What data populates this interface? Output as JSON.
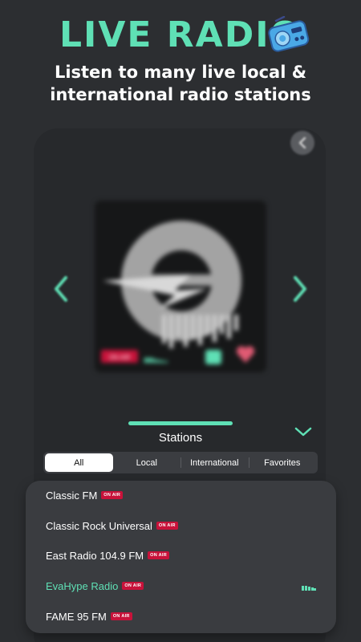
{
  "hero": {
    "title": "LIVE RADIO",
    "subtitle_line1": "Listen to many live local &",
    "subtitle_line2": "international radio stations",
    "accent_color": "#5fe0b5"
  },
  "player": {
    "back_icon": "chevron-left-icon",
    "prev_icon": "chevron-left-icon",
    "next_icon": "chevron-right-icon",
    "on_air_badge": "ON AIR"
  },
  "stations_section": {
    "title": "Stations",
    "collapse_icon": "chevron-down-icon"
  },
  "filters": {
    "tabs": [
      "All",
      "Local",
      "International",
      "Favorites"
    ],
    "selected": "All"
  },
  "stations": [
    {
      "name": "Classic FM",
      "badge": "ON AIR"
    },
    {
      "name": "Classic Rock Universal",
      "badge": "ON AIR"
    },
    {
      "name": "East Radio 104.9 FM",
      "badge": "ON AIR"
    },
    {
      "name": "EvaHype Radio",
      "badge": "ON AIR"
    },
    {
      "name": "FAME 95 FM",
      "badge": "ON AIR"
    }
  ],
  "colors": {
    "background": "#2c2e31",
    "accent": "#5fe0b5",
    "badge": "#c8123a"
  }
}
